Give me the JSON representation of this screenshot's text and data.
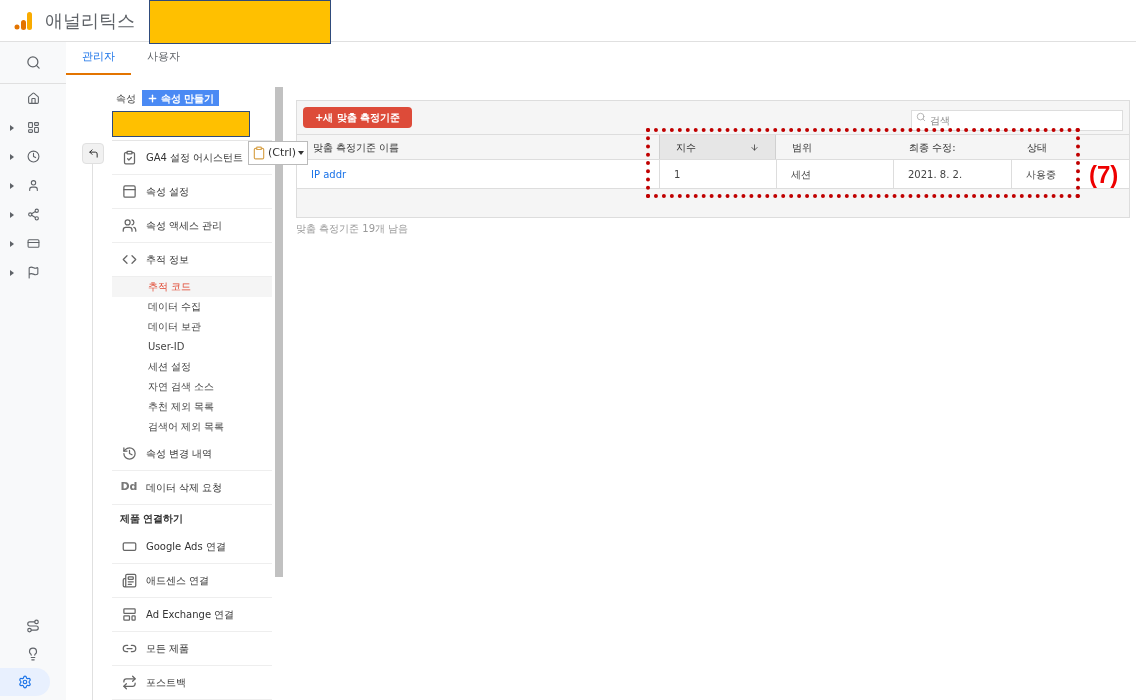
{
  "app": {
    "title": "애널리틱스"
  },
  "tabs": [
    {
      "label": "관리자",
      "selected": true
    },
    {
      "label": "사용자",
      "selected": false
    }
  ],
  "property": {
    "label": "속성",
    "create_button": "속성 만들기"
  },
  "paste_tooltip": "(Ctrl)",
  "nav": [
    {
      "kind": "item",
      "label": "GA4 설정 어시스턴트"
    },
    {
      "kind": "item",
      "label": "속성 설정"
    },
    {
      "kind": "item",
      "label": "속성 액세스 관리"
    },
    {
      "kind": "item",
      "label": "추적 정보",
      "children": [
        {
          "label": "추적 코드",
          "selected": true
        },
        {
          "label": "데이터 수집",
          "selected": false
        },
        {
          "label": "데이터 보관",
          "selected": false
        },
        {
          "label": "User-ID",
          "selected": false
        },
        {
          "label": "세션 설정",
          "selected": false
        },
        {
          "label": "자연 검색 소스",
          "selected": false
        },
        {
          "label": "추천 제외 목록",
          "selected": false
        },
        {
          "label": "검색어 제외 목록",
          "selected": false
        }
      ]
    },
    {
      "kind": "item",
      "label": "속성 변경 내역"
    },
    {
      "kind": "item",
      "label": "데이터 삭제 요청",
      "icon_text": "Dd"
    },
    {
      "kind": "heading",
      "label": "제품 연결하기"
    },
    {
      "kind": "item",
      "label": "Google Ads 연결"
    },
    {
      "kind": "item",
      "label": "애드센스 연결"
    },
    {
      "kind": "item",
      "label": "Ad Exchange 연결"
    },
    {
      "kind": "item",
      "label": "모든 제품"
    },
    {
      "kind": "item",
      "label": "포스트백"
    }
  ],
  "table": {
    "new_button": "+새 맞춤 측정기준",
    "search": {
      "placeholder": "검색"
    },
    "columns": [
      {
        "label": "맞춤 측정기준 이름",
        "sorted": false
      },
      {
        "label": "지수",
        "sorted": true
      },
      {
        "label": "범위",
        "sorted": false
      },
      {
        "label": "최종 수정:",
        "sorted": false
      },
      {
        "label": "상태",
        "sorted": false
      }
    ],
    "rows": [
      [
        "IP addr",
        "1",
        "세션",
        "2021. 8. 2.",
        "사용중"
      ]
    ],
    "footer": "맞춤 측정기준 19개 남음"
  },
  "annotation": "(7)"
}
